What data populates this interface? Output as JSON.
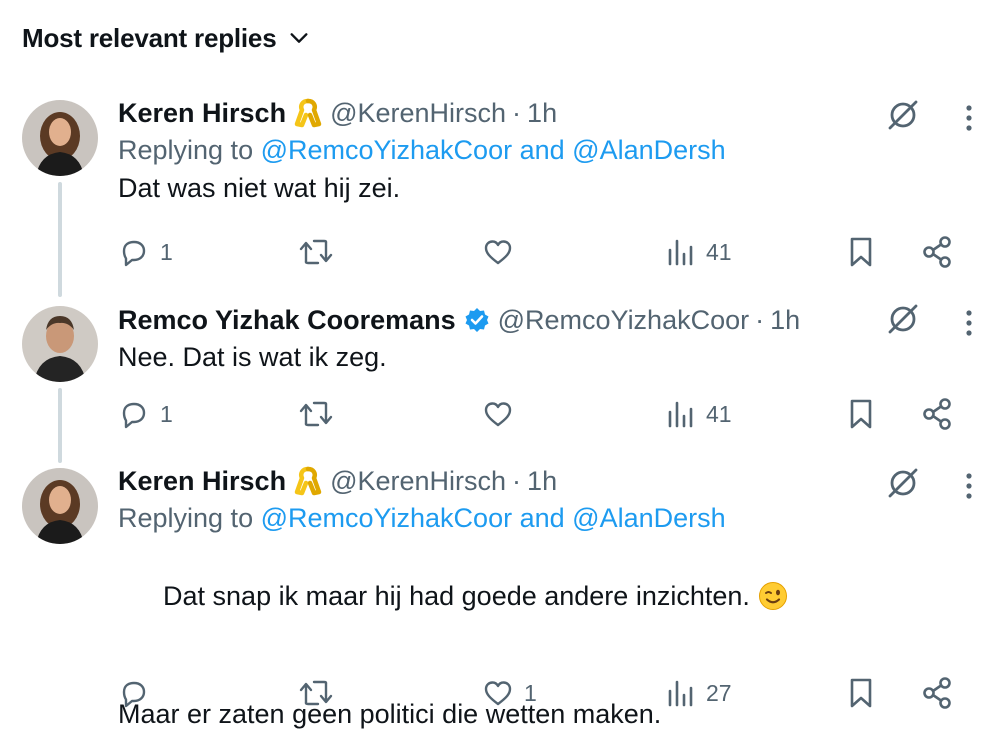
{
  "sort": {
    "label": "Most relevant replies"
  },
  "tweets": [
    {
      "name": "Keren Hirsch",
      "badge": "yellow-ribbon",
      "handle": "@KerenHirsch",
      "sep": "·",
      "time": "1h",
      "replying_prefix": "Replying to ",
      "mention1": "@RemcoYizhakCoor",
      "and_word": " and ",
      "mention2": "@AlanDersh",
      "text": "Dat was niet wat hij zei.",
      "replies": "1",
      "retweets": "",
      "likes": "",
      "views": "41"
    },
    {
      "name": "Remco Yizhak Cooremans",
      "badge": "verified",
      "handle": "@RemcoYizhakCoor",
      "sep": "·",
      "time": "1h",
      "text": "Nee. Dat is wat ik zeg.",
      "replies": "1",
      "retweets": "",
      "likes": "",
      "views": "41"
    },
    {
      "name": "Keren Hirsch",
      "badge": "yellow-ribbon",
      "handle": "@KerenHirsch",
      "sep": "·",
      "time": "1h",
      "replying_prefix": "Replying to ",
      "mention1": "@RemcoYizhakCoor",
      "and_word": " and ",
      "mention2": "@AlanDersh",
      "text_line1": "Dat snap ik maar hij had goede andere inzichten.",
      "emoji": "winking-face",
      "text_line2": "Maar er zaten geen politici die wetten maken.",
      "replies": "",
      "retweets": "",
      "likes": "1",
      "views": "27"
    }
  ],
  "colors": {
    "text": "#0f1419",
    "secondary": "#536471",
    "link": "#1d9bf0",
    "ribbon": "#f5c518",
    "verified": "#1d9bf0",
    "thread_line": "#cfd9de"
  }
}
